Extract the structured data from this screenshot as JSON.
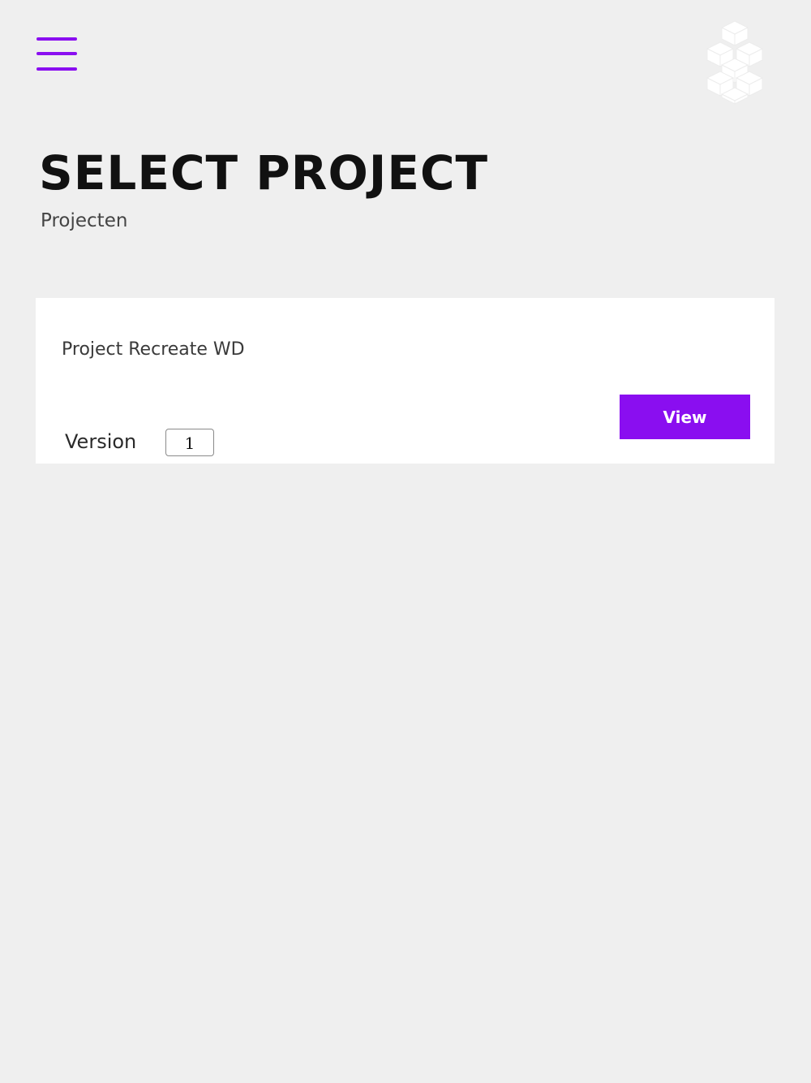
{
  "colors": {
    "accent": "#8a0ef0",
    "background": "#efefef",
    "card": "#ffffff",
    "logo": "#ffffff"
  },
  "header": {
    "menu_icon": "hamburger-menu-icon",
    "logo_icon": "stacked-blocks-logo"
  },
  "page": {
    "title": "SELECT PROJECT",
    "subtitle": "Projecten"
  },
  "projects": [
    {
      "name": "Project Recreate WD",
      "version_label": "Version",
      "version_value": "1",
      "view_label": "View"
    }
  ]
}
